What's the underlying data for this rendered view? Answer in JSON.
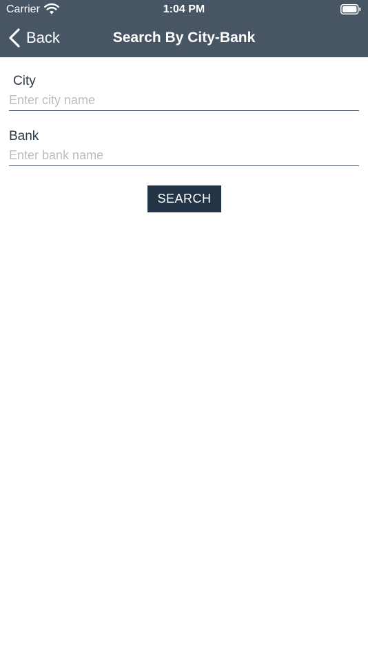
{
  "status_bar": {
    "carrier": "Carrier",
    "time": "1:04 PM",
    "wifi_icon": "wifi-icon",
    "battery_icon": "battery-icon"
  },
  "nav": {
    "back_label": "Back",
    "back_icon": "chevron-left-icon",
    "title": "Search By City-Bank"
  },
  "form": {
    "city": {
      "label": "City",
      "placeholder": "Enter city name",
      "value": ""
    },
    "bank": {
      "label": "Bank",
      "placeholder": "Enter bank name",
      "value": ""
    },
    "search_label": "SEARCH"
  },
  "colors": {
    "header_bg": "#485564",
    "button_bg": "#243447",
    "text": "#2c3847",
    "placeholder": "#bdbdbd"
  }
}
